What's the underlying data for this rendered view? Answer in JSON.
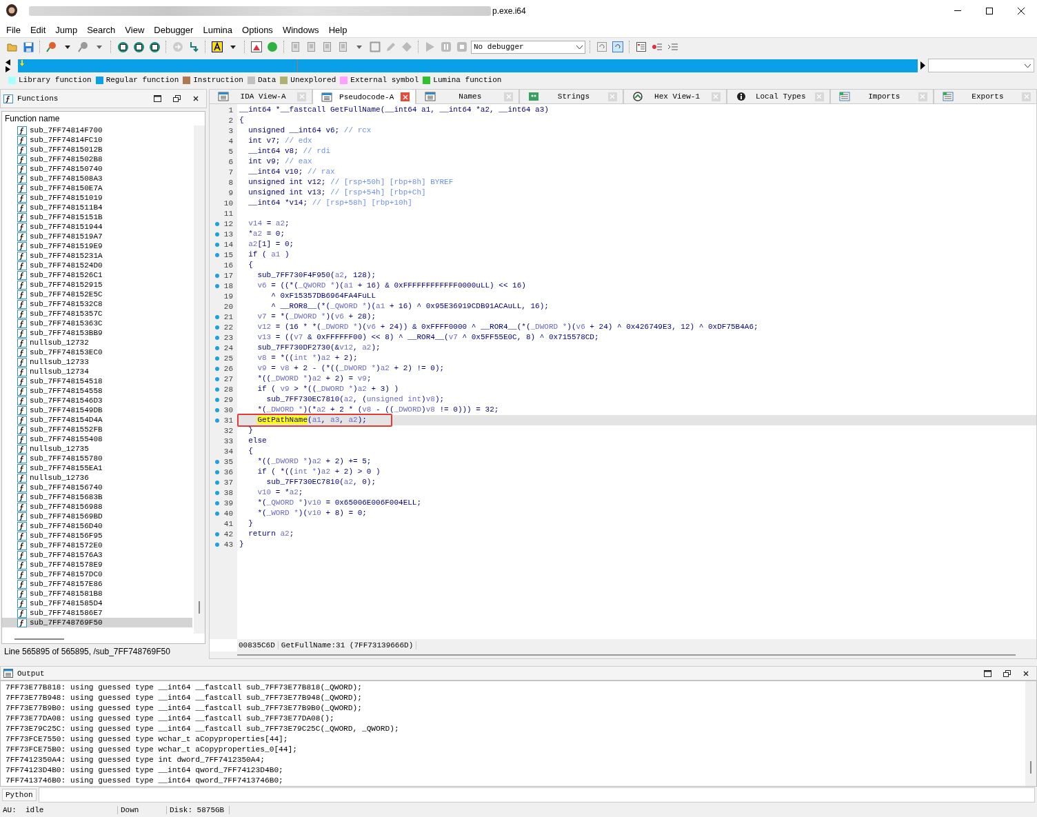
{
  "window": {
    "title": "p.exe.i64"
  },
  "menu": [
    "File",
    "Edit",
    "Jump",
    "Search",
    "View",
    "Debugger",
    "Lumina",
    "Options",
    "Windows",
    "Help"
  ],
  "toolbar": {
    "debugger": "No debugger"
  },
  "legend": [
    {
      "label": "Library function",
      "color": "#aaffff"
    },
    {
      "label": "Regular function",
      "color": "#0aa0e8"
    },
    {
      "label": "Instruction",
      "color": "#b07850"
    },
    {
      "label": "Data",
      "color": "#c0c0c0"
    },
    {
      "label": "Unexplored",
      "color": "#b0b070"
    },
    {
      "label": "External symbol",
      "color": "#ffa0ff"
    },
    {
      "label": "Lumina function",
      "color": "#30c030"
    }
  ],
  "functions_panel": {
    "title": "Functions",
    "column": "Function name",
    "status": "Line 565895 of 565895, /sub_7FF748769F50",
    "items": [
      {
        "name": "sub_7FF74814F700",
        "selected": false
      },
      {
        "name": "sub_7FF74814FC10",
        "selected": false
      },
      {
        "name": "sub_7FF74815012B",
        "selected": false
      },
      {
        "name": "sub_7FF7481502B8",
        "selected": false
      },
      {
        "name": "sub_7FF748150740",
        "selected": false
      },
      {
        "name": "sub_7FF7481508A3",
        "selected": false
      },
      {
        "name": "sub_7FF748150E7A",
        "selected": false
      },
      {
        "name": "sub_7FF748151019",
        "selected": false
      },
      {
        "name": "sub_7FF7481511B4",
        "selected": false
      },
      {
        "name": "sub_7FF74815151B",
        "selected": false
      },
      {
        "name": "sub_7FF748151944",
        "selected": false
      },
      {
        "name": "sub_7FF7481519A7",
        "selected": false
      },
      {
        "name": "sub_7FF7481519E9",
        "selected": false
      },
      {
        "name": "sub_7FF74815231A",
        "selected": false
      },
      {
        "name": "sub_7FF7481524D0",
        "selected": false
      },
      {
        "name": "sub_7FF7481526C1",
        "selected": false
      },
      {
        "name": "sub_7FF748152915",
        "selected": false
      },
      {
        "name": "sub_7FF748152E5C",
        "selected": false
      },
      {
        "name": "sub_7FF7481532C8",
        "selected": false
      },
      {
        "name": "sub_7FF74815357C",
        "selected": false
      },
      {
        "name": "sub_7FF74815363C",
        "selected": false
      },
      {
        "name": "sub_7FF748153BB9",
        "selected": false
      },
      {
        "name": "nullsub_12732",
        "selected": false
      },
      {
        "name": "sub_7FF748153EC0",
        "selected": false
      },
      {
        "name": "nullsub_12733",
        "selected": false
      },
      {
        "name": "nullsub_12734",
        "selected": false
      },
      {
        "name": "sub_7FF748154518",
        "selected": false
      },
      {
        "name": "sub_7FF748154558",
        "selected": false
      },
      {
        "name": "sub_7FF7481546D3",
        "selected": false
      },
      {
        "name": "sub_7FF7481549DB",
        "selected": false
      },
      {
        "name": "sub_7FF748154D4A",
        "selected": false
      },
      {
        "name": "sub_7FF7481552FB",
        "selected": false
      },
      {
        "name": "sub_7FF748155408",
        "selected": false
      },
      {
        "name": "nullsub_12735",
        "selected": false
      },
      {
        "name": "sub_7FF748155780",
        "selected": false
      },
      {
        "name": "sub_7FF748155EA1",
        "selected": false
      },
      {
        "name": "nullsub_12736",
        "selected": false
      },
      {
        "name": "sub_7FF748156740",
        "selected": false
      },
      {
        "name": "sub_7FF74815683B",
        "selected": false
      },
      {
        "name": "sub_7FF748156988",
        "selected": false
      },
      {
        "name": "sub_7FF7481569BD",
        "selected": false
      },
      {
        "name": "sub_7FF748156D40",
        "selected": false
      },
      {
        "name": "sub_7FF748156F95",
        "selected": false
      },
      {
        "name": "sub_7FF7481572E0",
        "selected": false
      },
      {
        "name": "sub_7FF7481576A3",
        "selected": false
      },
      {
        "name": "sub_7FF7481578E9",
        "selected": false
      },
      {
        "name": "sub_7FF748157DC0",
        "selected": false
      },
      {
        "name": "sub_7FF748157E86",
        "selected": false
      },
      {
        "name": "sub_7FF7481581B8",
        "selected": false
      },
      {
        "name": "sub_7FF7481585D4",
        "selected": false
      },
      {
        "name": "sub_7FF7481586E7",
        "selected": false
      },
      {
        "name": "sub_7FF748769F50",
        "selected": true
      }
    ]
  },
  "tabs": [
    {
      "label": "IDA View-A",
      "kind": "disasm",
      "selected": false
    },
    {
      "label": "Pseudocode-A",
      "kind": "pseudo",
      "selected": true
    },
    {
      "label": "Names",
      "kind": "names",
      "selected": false
    },
    {
      "label": "Strings",
      "kind": "strings",
      "selected": false
    },
    {
      "label": "Hex View-1",
      "kind": "hex",
      "selected": false
    },
    {
      "label": "Local Types",
      "kind": "types",
      "selected": false
    },
    {
      "label": "Imports",
      "kind": "imports",
      "selected": false
    },
    {
      "label": "Exports",
      "kind": "exports",
      "selected": false
    }
  ],
  "code": {
    "location": "00835C6D",
    "position": "GetFullName:31",
    "address": "(7FF73139666D)",
    "lines": [
      {
        "n": "1",
        "dot": false,
        "selected": false,
        "seg": [
          {
            "kind": "text",
            "text": "__int64 *__fastcall GetFullName(__int64 a1, __int64 *a2, __int64 a3)"
          }
        ]
      },
      {
        "n": "2",
        "dot": false,
        "selected": false,
        "seg": [
          {
            "kind": "text",
            "text": "{"
          }
        ]
      },
      {
        "n": "3",
        "dot": false,
        "selected": false,
        "seg": [
          {
            "kind": "text",
            "text": "  unsigned __int64 v6; "
          },
          {
            "kind": "comment",
            "text": "// rcx"
          }
        ]
      },
      {
        "n": "4",
        "dot": false,
        "selected": false,
        "seg": [
          {
            "kind": "text",
            "text": "  int v7; "
          },
          {
            "kind": "comment",
            "text": "// edx"
          }
        ]
      },
      {
        "n": "5",
        "dot": false,
        "selected": false,
        "seg": [
          {
            "kind": "text",
            "text": "  __int64 v8; "
          },
          {
            "kind": "comment",
            "text": "// rdi"
          }
        ]
      },
      {
        "n": "6",
        "dot": false,
        "selected": false,
        "seg": [
          {
            "kind": "text",
            "text": "  int v9; "
          },
          {
            "kind": "comment",
            "text": "// eax"
          }
        ]
      },
      {
        "n": "7",
        "dot": false,
        "selected": false,
        "seg": [
          {
            "kind": "text",
            "text": "  __int64 v10; "
          },
          {
            "kind": "comment",
            "text": "// rax"
          }
        ]
      },
      {
        "n": "8",
        "dot": false,
        "selected": false,
        "seg": [
          {
            "kind": "text",
            "text": "  unsigned int v12; "
          },
          {
            "kind": "comment",
            "text": "// [rsp+50h] [rbp+8h] BYREF"
          }
        ]
      },
      {
        "n": "9",
        "dot": false,
        "selected": false,
        "seg": [
          {
            "kind": "text",
            "text": "  unsigned int v13; "
          },
          {
            "kind": "comment",
            "text": "// [rsp+54h] [rbp+Ch]"
          }
        ]
      },
      {
        "n": "10",
        "dot": false,
        "selected": false,
        "seg": [
          {
            "kind": "text",
            "text": "  __int64 *v14; "
          },
          {
            "kind": "comment",
            "text": "// [rsp+58h] [rbp+10h]"
          }
        ]
      },
      {
        "n": "11",
        "dot": false,
        "selected": false
      },
      {
        "n": "12",
        "dot": true,
        "selected": false,
        "seg": [
          {
            "kind": "var",
            "text": "  v14"
          },
          {
            "kind": "text",
            "text": " = "
          },
          {
            "kind": "var",
            "text": "a2"
          },
          {
            "kind": "text",
            "text": ";"
          }
        ]
      },
      {
        "n": "13",
        "dot": true,
        "selected": false,
        "seg": [
          {
            "kind": "text",
            "text": "  *"
          },
          {
            "kind": "var",
            "text": "a2"
          },
          {
            "kind": "text",
            "text": " = 0;"
          }
        ]
      },
      {
        "n": "14",
        "dot": true,
        "selected": false,
        "seg": [
          {
            "kind": "var",
            "text": "  a2"
          },
          {
            "kind": "text",
            "text": "[1] = 0;"
          }
        ]
      },
      {
        "n": "15",
        "dot": true,
        "selected": false,
        "seg": [
          {
            "kind": "text",
            "text": "  if ( "
          },
          {
            "kind": "var",
            "text": "a1"
          },
          {
            "kind": "text",
            "text": " )"
          }
        ]
      },
      {
        "n": "16",
        "dot": false,
        "selected": false,
        "seg": [
          {
            "kind": "text",
            "text": "  {"
          }
        ]
      },
      {
        "n": "17",
        "dot": true,
        "selected": false,
        "seg": [
          {
            "kind": "text",
            "text": "    sub_7FF730F4F950("
          },
          {
            "kind": "var",
            "text": "a2"
          },
          {
            "kind": "text",
            "text": ", 128);"
          }
        ]
      },
      {
        "n": "18",
        "dot": true,
        "selected": false,
        "seg": [
          {
            "kind": "var",
            "text": "    v6"
          },
          {
            "kind": "text",
            "text": " = ((*("
          },
          {
            "kind": "var",
            "text": "_QWORD *"
          },
          {
            "kind": "text",
            "text": ")("
          },
          {
            "kind": "var",
            "text": "a1"
          },
          {
            "kind": "text",
            "text": " + 16) & 0xFFFFFFFFFFFF0000uLL) << 16)"
          }
        ]
      },
      {
        "n": "19",
        "dot": false,
        "selected": false,
        "seg": [
          {
            "kind": "text",
            "text": "       ^ 0xF15357DB6964FA4FuLL"
          }
        ]
      },
      {
        "n": "20",
        "dot": false,
        "selected": false,
        "seg": [
          {
            "kind": "text",
            "text": "       ^ __ROR8__(*("
          },
          {
            "kind": "var",
            "text": "_QWORD *"
          },
          {
            "kind": "text",
            "text": ")("
          },
          {
            "kind": "var",
            "text": "a1"
          },
          {
            "kind": "text",
            "text": " + 16) ^ 0x95E36919CDB91ACAuLL, 16);"
          }
        ]
      },
      {
        "n": "21",
        "dot": true,
        "selected": false,
        "seg": [
          {
            "kind": "var",
            "text": "    v7"
          },
          {
            "kind": "text",
            "text": " = *("
          },
          {
            "kind": "var",
            "text": "_DWORD *"
          },
          {
            "kind": "text",
            "text": ")("
          },
          {
            "kind": "var",
            "text": "v6"
          },
          {
            "kind": "text",
            "text": " + 28);"
          }
        ]
      },
      {
        "n": "22",
        "dot": true,
        "selected": false,
        "seg": [
          {
            "kind": "var",
            "text": "    v12"
          },
          {
            "kind": "text",
            "text": " = (16 * *("
          },
          {
            "kind": "var",
            "text": "_DWORD *"
          },
          {
            "kind": "text",
            "text": ")("
          },
          {
            "kind": "var",
            "text": "v6"
          },
          {
            "kind": "text",
            "text": " + 24)) & 0xFFFF0000 ^ __ROR4__(*("
          },
          {
            "kind": "var",
            "text": "_DWORD *"
          },
          {
            "kind": "text",
            "text": ")("
          },
          {
            "kind": "var",
            "text": "v6"
          },
          {
            "kind": "text",
            "text": " + 24) ^ 0x426749E3, 12) ^ 0xDF75B4A6;"
          }
        ]
      },
      {
        "n": "23",
        "dot": true,
        "selected": false,
        "seg": [
          {
            "kind": "var",
            "text": "    v13"
          },
          {
            "kind": "text",
            "text": " = (("
          },
          {
            "kind": "var",
            "text": "v7"
          },
          {
            "kind": "text",
            "text": " & 0xFFFFFF00) << 8) ^ __ROR4__("
          },
          {
            "kind": "var",
            "text": "v7"
          },
          {
            "kind": "text",
            "text": " ^ 0x5FF55E0C, 8) ^ 0x715578CD;"
          }
        ]
      },
      {
        "n": "24",
        "dot": true,
        "selected": false,
        "seg": [
          {
            "kind": "text",
            "text": "    sub_7FF730DF2730(&"
          },
          {
            "kind": "var",
            "text": "v12"
          },
          {
            "kind": "text",
            "text": ", "
          },
          {
            "kind": "var",
            "text": "a2"
          },
          {
            "kind": "text",
            "text": ");"
          }
        ]
      },
      {
        "n": "25",
        "dot": true,
        "selected": false,
        "seg": [
          {
            "kind": "var",
            "text": "    v8"
          },
          {
            "kind": "text",
            "text": " = *(("
          },
          {
            "kind": "var",
            "text": "int *"
          },
          {
            "kind": "text",
            "text": ")"
          },
          {
            "kind": "var",
            "text": "a2"
          },
          {
            "kind": "text",
            "text": " + 2);"
          }
        ]
      },
      {
        "n": "26",
        "dot": true,
        "selected": false,
        "seg": [
          {
            "kind": "var",
            "text": "    v9"
          },
          {
            "kind": "text",
            "text": " = "
          },
          {
            "kind": "var",
            "text": "v8"
          },
          {
            "kind": "text",
            "text": " + 2 - (*(("
          },
          {
            "kind": "var",
            "text": "_DWORD *"
          },
          {
            "kind": "text",
            "text": ")"
          },
          {
            "kind": "var",
            "text": "a2"
          },
          {
            "kind": "text",
            "text": " + 2) != 0);"
          }
        ]
      },
      {
        "n": "27",
        "dot": true,
        "selected": false,
        "seg": [
          {
            "kind": "text",
            "text": "    *(("
          },
          {
            "kind": "var",
            "text": "_DWORD *"
          },
          {
            "kind": "text",
            "text": ")"
          },
          {
            "kind": "var",
            "text": "a2"
          },
          {
            "kind": "text",
            "text": " + 2) = "
          },
          {
            "kind": "var",
            "text": "v9"
          },
          {
            "kind": "text",
            "text": ";"
          }
        ]
      },
      {
        "n": "28",
        "dot": true,
        "selected": false,
        "seg": [
          {
            "kind": "text",
            "text": "    if ( "
          },
          {
            "kind": "var",
            "text": "v9"
          },
          {
            "kind": "text",
            "text": " > *(("
          },
          {
            "kind": "var",
            "text": "_DWORD *"
          },
          {
            "kind": "text",
            "text": ")"
          },
          {
            "kind": "var",
            "text": "a2"
          },
          {
            "kind": "text",
            "text": " + 3) )"
          }
        ]
      },
      {
        "n": "29",
        "dot": true,
        "selected": false,
        "seg": [
          {
            "kind": "text",
            "text": "      sub_7FF730EC7810("
          },
          {
            "kind": "var",
            "text": "a2"
          },
          {
            "kind": "text",
            "text": ", ("
          },
          {
            "kind": "var",
            "text": "unsigned int"
          },
          {
            "kind": "text",
            "text": ")"
          },
          {
            "kind": "var",
            "text": "v8"
          },
          {
            "kind": "text",
            "text": ");"
          }
        ]
      },
      {
        "n": "30",
        "dot": true,
        "selected": false,
        "seg": [
          {
            "kind": "text",
            "text": "    *("
          },
          {
            "kind": "var",
            "text": "_DWORD *"
          },
          {
            "kind": "text",
            "text": ")(*"
          },
          {
            "kind": "var",
            "text": "a2"
          },
          {
            "kind": "text",
            "text": " + 2 * ("
          },
          {
            "kind": "var",
            "text": "v8"
          },
          {
            "kind": "text",
            "text": " - (("
          },
          {
            "kind": "var",
            "text": "_DWORD"
          },
          {
            "kind": "text",
            "text": ")"
          },
          {
            "kind": "var",
            "text": "v8"
          },
          {
            "kind": "text",
            "text": " != 0))) = 32;"
          }
        ]
      },
      {
        "n": "31",
        "dot": true,
        "selected": true,
        "boxed": true,
        "seg": [
          {
            "kind": "mark",
            "text": "    GetPathName"
          },
          {
            "kind": "text",
            "text": "("
          },
          {
            "kind": "var",
            "text": "a1"
          },
          {
            "kind": "text",
            "text": ", "
          },
          {
            "kind": "var",
            "text": "a3"
          },
          {
            "kind": "text",
            "text": ", "
          },
          {
            "kind": "var",
            "text": "a2"
          },
          {
            "kind": "text",
            "text": ");"
          }
        ]
      },
      {
        "n": "32",
        "dot": false,
        "selected": false,
        "seg": [
          {
            "kind": "text",
            "text": "  }"
          }
        ]
      },
      {
        "n": "33",
        "dot": false,
        "selected": false,
        "seg": [
          {
            "kind": "text",
            "text": "  else"
          }
        ]
      },
      {
        "n": "34",
        "dot": false,
        "selected": false,
        "seg": [
          {
            "kind": "text",
            "text": "  {"
          }
        ]
      },
      {
        "n": "35",
        "dot": true,
        "selected": false,
        "seg": [
          {
            "kind": "text",
            "text": "    *(("
          },
          {
            "kind": "var",
            "text": "_DWORD *"
          },
          {
            "kind": "text",
            "text": ")"
          },
          {
            "kind": "var",
            "text": "a2"
          },
          {
            "kind": "text",
            "text": " + 2) += 5;"
          }
        ]
      },
      {
        "n": "36",
        "dot": true,
        "selected": false,
        "seg": [
          {
            "kind": "text",
            "text": "    if ( *(("
          },
          {
            "kind": "var",
            "text": "int *"
          },
          {
            "kind": "text",
            "text": ")"
          },
          {
            "kind": "var",
            "text": "a2"
          },
          {
            "kind": "text",
            "text": " + 2) > 0 )"
          }
        ]
      },
      {
        "n": "37",
        "dot": true,
        "selected": false,
        "seg": [
          {
            "kind": "text",
            "text": "      sub_7FF730EC7810("
          },
          {
            "kind": "var",
            "text": "a2"
          },
          {
            "kind": "text",
            "text": ", 0);"
          }
        ]
      },
      {
        "n": "38",
        "dot": true,
        "selected": false,
        "seg": [
          {
            "kind": "var",
            "text": "    v10"
          },
          {
            "kind": "text",
            "text": " = *"
          },
          {
            "kind": "var",
            "text": "a2"
          },
          {
            "kind": "text",
            "text": ";"
          }
        ]
      },
      {
        "n": "39",
        "dot": true,
        "selected": false,
        "seg": [
          {
            "kind": "text",
            "text": "    *("
          },
          {
            "kind": "var",
            "text": "_QWORD *"
          },
          {
            "kind": "text",
            "text": ")"
          },
          {
            "kind": "var",
            "text": "v10"
          },
          {
            "kind": "text",
            "text": " = 0x65006E006F004ELL;"
          }
        ]
      },
      {
        "n": "40",
        "dot": true,
        "selected": false,
        "seg": [
          {
            "kind": "text",
            "text": "    *("
          },
          {
            "kind": "var",
            "text": "_WORD *"
          },
          {
            "kind": "text",
            "text": ")("
          },
          {
            "kind": "var",
            "text": "v10"
          },
          {
            "kind": "text",
            "text": " + 8) = 0;"
          }
        ]
      },
      {
        "n": "41",
        "dot": false,
        "selected": false,
        "seg": [
          {
            "kind": "text",
            "text": "  }"
          }
        ]
      },
      {
        "n": "42",
        "dot": true,
        "selected": false,
        "seg": [
          {
            "kind": "text",
            "text": "  return "
          },
          {
            "kind": "var",
            "text": "a2"
          },
          {
            "kind": "text",
            "text": ";"
          }
        ]
      },
      {
        "n": "43",
        "dot": true,
        "selected": false,
        "seg": [
          {
            "kind": "text",
            "text": "}"
          }
        ]
      }
    ]
  },
  "output": {
    "title": "Output",
    "lines": [
      "7FF73E77B818: using guessed type __int64 __fastcall sub_7FF73E77B818(_QWORD);",
      "7FF73E77B948: using guessed type __int64 __fastcall sub_7FF73E77B948(_QWORD);",
      "7FF73E77B9B0: using guessed type __int64 __fastcall sub_7FF73E77B9B0(_QWORD);",
      "7FF73E77DA08: using guessed type __int64 __fastcall sub_7FF73E77DA08();",
      "7FF73E79C25C: using guessed type __int64 __fastcall sub_7FF73E79C25C(_QWORD, _QWORD);",
      "7FF73FCE7550: using guessed type wchar_t aCopyproperties[44];",
      "7FF73FCE75B0: using guessed type wchar_t aCopyproperties_0[44];",
      "7FF7412350A4: using guessed type int dword_7FF7412350A4;",
      "7FF74123D4B0: using guessed type __int64 qword_7FF74123D4B0;",
      "7FF7413746B0: using guessed type __int64 qword_7FF7413746B0;"
    ]
  },
  "python": {
    "label": "Python"
  },
  "status_bar": [
    "AU:  idle",
    "Down",
    "Disk: 5875GB"
  ]
}
